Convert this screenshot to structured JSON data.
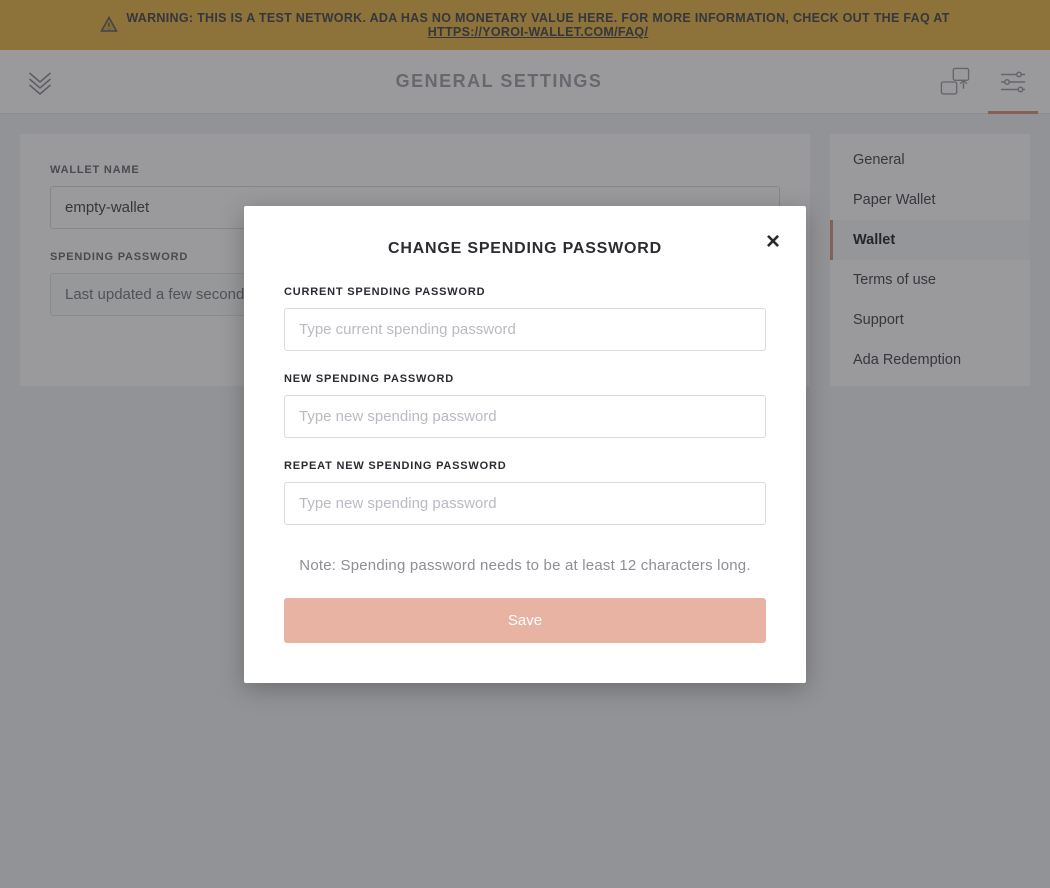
{
  "banner": {
    "warning_text_1": "WARNING: THIS IS A TEST NETWORK. ADA HAS NO MONETARY VALUE HERE. FOR MORE INFORMATION, CHECK OUT THE FAQ AT ",
    "faq_url_label": "HTTPS://YOROI-WALLET.COM/FAQ/"
  },
  "topbar": {
    "title": "GENERAL SETTINGS"
  },
  "settings": {
    "wallet_name_label": "WALLET NAME",
    "wallet_name_value": "empty-wallet",
    "spending_password_label": "SPENDING PASSWORD",
    "spending_password_status": "Last updated a few seconds ago"
  },
  "side_nav": {
    "items": [
      {
        "label": "General",
        "active": false
      },
      {
        "label": "Paper Wallet",
        "active": false
      },
      {
        "label": "Wallet",
        "active": true
      },
      {
        "label": "Terms of use",
        "active": false
      },
      {
        "label": "Support",
        "active": false
      },
      {
        "label": "Ada Redemption",
        "active": false
      }
    ]
  },
  "modal": {
    "title": "CHANGE SPENDING PASSWORD",
    "current_label": "CURRENT SPENDING PASSWORD",
    "current_placeholder": "Type current spending password",
    "new_label": "NEW SPENDING PASSWORD",
    "new_placeholder": "Type new spending password",
    "repeat_label": "REPEAT NEW SPENDING PASSWORD",
    "repeat_placeholder": "Type new spending password",
    "note": "Note: Spending password needs to be at least 12 characters long.",
    "save_label": "Save"
  }
}
